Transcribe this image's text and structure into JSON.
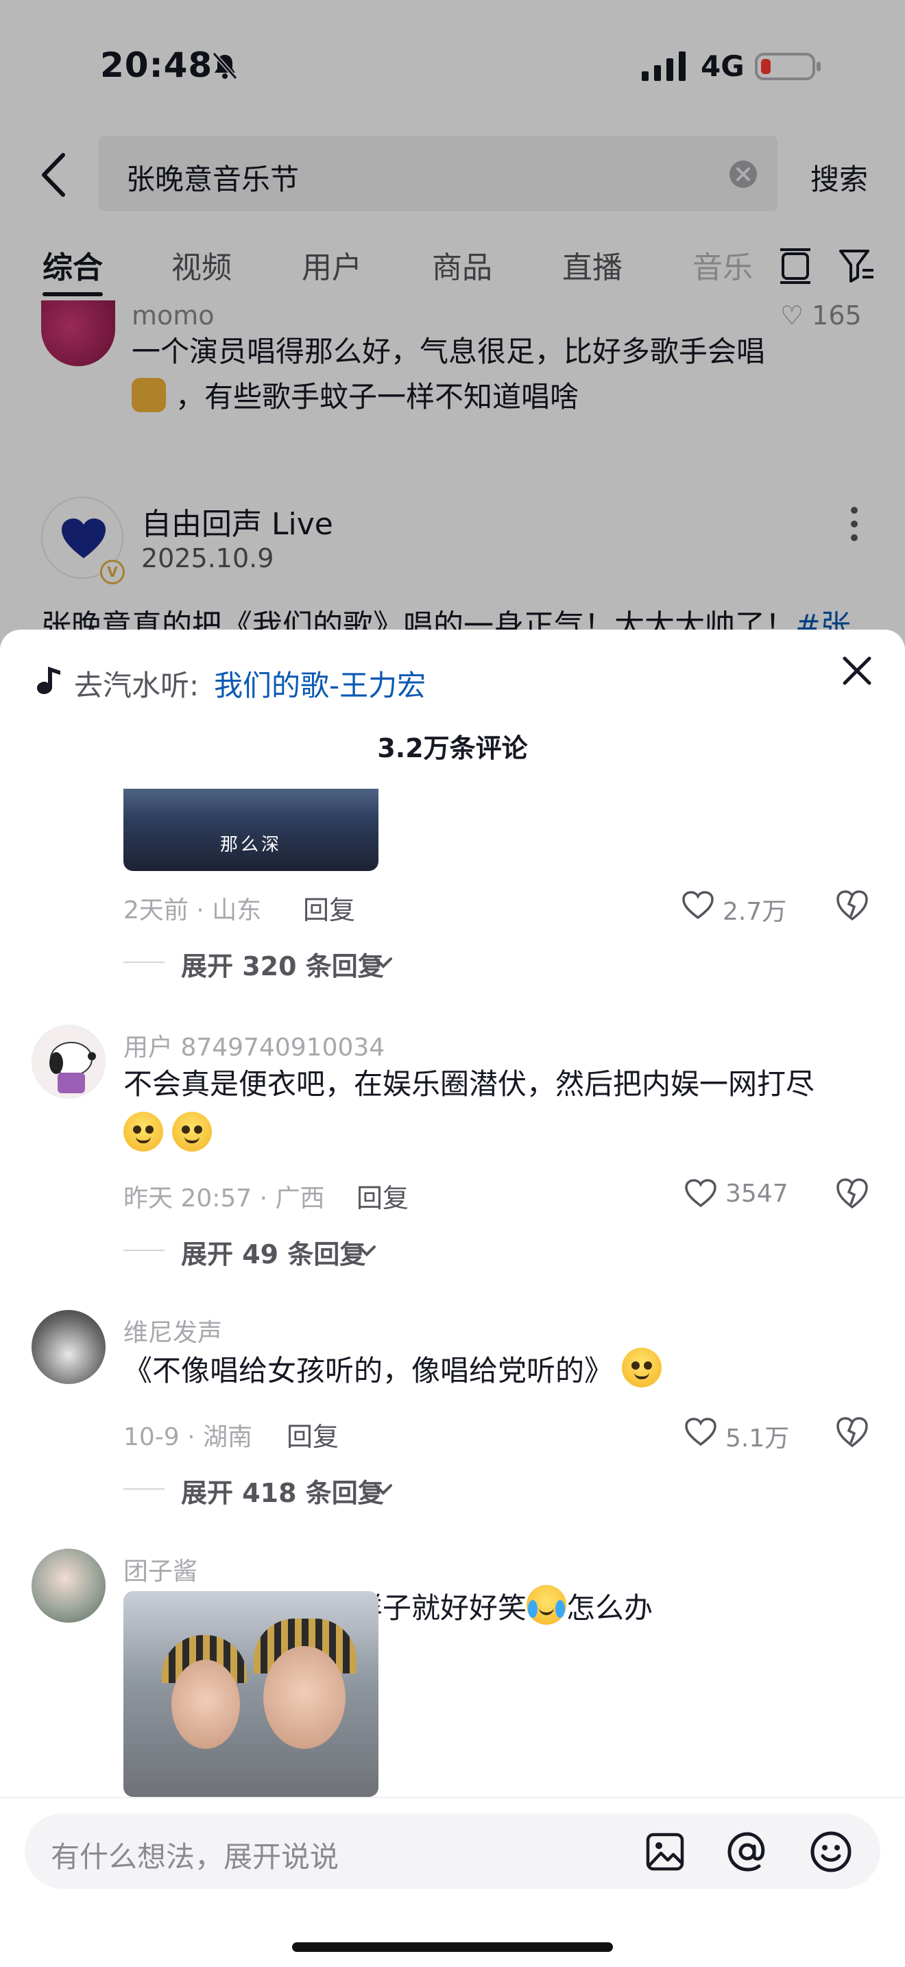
{
  "status_bar": {
    "time": "20:48",
    "network": "4G"
  },
  "search": {
    "query": "张晚意音乐节",
    "button": "搜索"
  },
  "tabs": [
    "综合",
    "视频",
    "用户",
    "商品",
    "直播",
    "音乐"
  ],
  "background_feed": {
    "card1": {
      "user": "momo",
      "likes": "165",
      "text_line1": "一个演员唱得那么好，气息很足，比好多歌手会唱",
      "text_line2": "，有些歌手蚊子一样不知道唱啥"
    },
    "card2": {
      "name": "自由回声 Live",
      "date": "2025.10.9",
      "text": "张晚意真的把《我们的歌》唱的一身正气！太太太帅了！",
      "tag": "#张"
    }
  },
  "sheet": {
    "music_prefix": "去汽水听:",
    "music_title": "我们的歌-王力宏",
    "comment_count": "3.2万条评论"
  },
  "comments": [
    {
      "thumb_caption": "那么深",
      "meta": "2天前 · 山东",
      "reply": "回复",
      "likes": "2.7万",
      "expand": "展开 320 条回复"
    },
    {
      "user": "用户 8749740910034",
      "text": "不会真是便衣吧，在娱乐圈潜伏，然后把内娱一网打尽",
      "meta": "昨天 20:57 · 广西",
      "reply": "回复",
      "likes": "3547",
      "expand": "展开 49 条回复"
    },
    {
      "user": "维尼发声",
      "text": "《不像唱给女孩听的，像唱给党听的》",
      "meta": "10-9 · 湖南",
      "reply": "回复",
      "likes": "5.1万",
      "expand": "展开 418 条回复"
    },
    {
      "user": "团子酱",
      "text_before": "他每次一本正经的样子就好好笑",
      "text_after": "怎么办"
    }
  ],
  "input": {
    "placeholder": "有什么想法，展开说说"
  },
  "colors": {
    "link": "#0b59b3",
    "battery_low": "#ff3b30",
    "verified": "#e3b046"
  },
  "icons": [
    "bell-slash-icon",
    "signal-icon",
    "battery-icon",
    "back-icon",
    "clear-icon",
    "layout-icon",
    "filter-icon",
    "more-icon",
    "music-note-icon",
    "close-icon",
    "heart-icon",
    "dislike-icon",
    "chevron-down-icon",
    "image-icon",
    "at-icon",
    "emoji-icon"
  ]
}
